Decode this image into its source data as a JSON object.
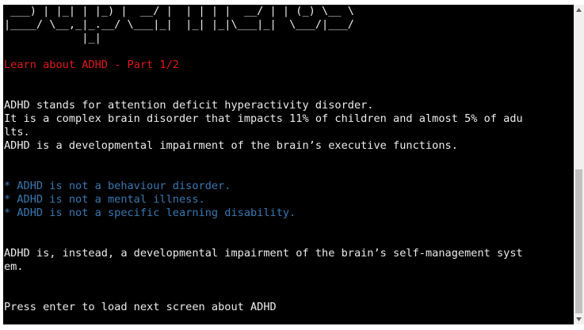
{
  "terminal": {
    "ascii_art": [
      " ___) | |_| | |_) |  __/ |  | | | |  __/ | | (_) \\__ \\",
      "|____/ \\__,_|_.__/ \\___|_|  |_| |_|\\___|_|  \\___/|___/",
      "            |_|"
    ],
    "heading": "Learn about ADHD - Part 1/2",
    "intro_lines": [
      "ADHD stands for attention deficit hyperactivity disorder.",
      "It is a complex brain disorder that impacts 11% of children and almost 5% of adu",
      "lts.",
      "ADHD is a developmental impairment of the brain’s executive functions."
    ],
    "bullets": [
      "* ADHD is not a behaviour disorder.",
      "* ADHD is not a mental illness.",
      "* ADHD is not a specific learning disability."
    ],
    "conclusion_lines": [
      "ADHD is, instead, a developmental impairment of the brain’s self-management syst",
      "em."
    ],
    "prompt": "Press enter to load next screen about ADHD"
  },
  "colors": {
    "background": "#000000",
    "text": "#ececec",
    "heading": "#e01b1b",
    "bullet": "#3b78b0",
    "scrollbar_track": "#f0f0f0",
    "scrollbar_thumb": "#c1c1c1"
  },
  "scrollbar": {
    "up_icon": "chevron-up-icon",
    "down_icon": "chevron-down-icon"
  }
}
